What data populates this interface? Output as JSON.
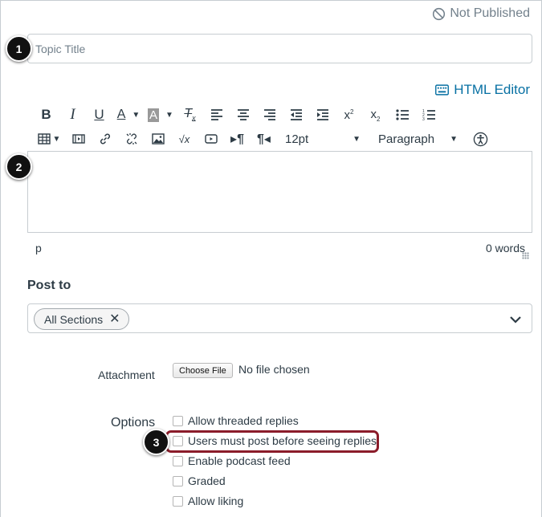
{
  "status": {
    "text": "Not Published",
    "icon": "not-published-icon"
  },
  "topic": {
    "placeholder": "Topic Title"
  },
  "markers": [
    "1",
    "2",
    "3"
  ],
  "html_editor": {
    "label": "HTML Editor",
    "icon": "keyboard-icon"
  },
  "toolbar": {
    "row1": [
      "bold-icon",
      "italic-icon",
      "underline-icon",
      "text-color-icon",
      "background-color-icon",
      "clear-formatting-icon",
      "align-left-icon",
      "align-center-icon",
      "align-right-icon",
      "outdent-icon",
      "indent-icon",
      "superscript-icon",
      "subscript-icon",
      "bullet-list-icon",
      "numbered-list-icon"
    ],
    "row2": [
      "table-icon",
      "media-icon",
      "link-icon",
      "unlink-icon",
      "image-icon",
      "math-icon",
      "embed-icon",
      "ltr-icon",
      "rtl-icon",
      "accessibility-icon"
    ],
    "font_size": "12pt",
    "block_format": "Paragraph"
  },
  "editor": {
    "path": "p",
    "word_count": "0 words"
  },
  "post_to": {
    "label": "Post to",
    "tag": "All Sections"
  },
  "attachment": {
    "label": "Attachment",
    "button": "Choose File",
    "status": "No file chosen"
  },
  "options": {
    "label": "Options",
    "items": [
      "Allow threaded replies",
      "Users must post before seeing replies",
      "Enable podcast feed",
      "Graded",
      "Allow liking"
    ]
  },
  "colors": {
    "link": "#0770a3",
    "highlight": "#8b1c2a",
    "text": "#2d3b45"
  }
}
